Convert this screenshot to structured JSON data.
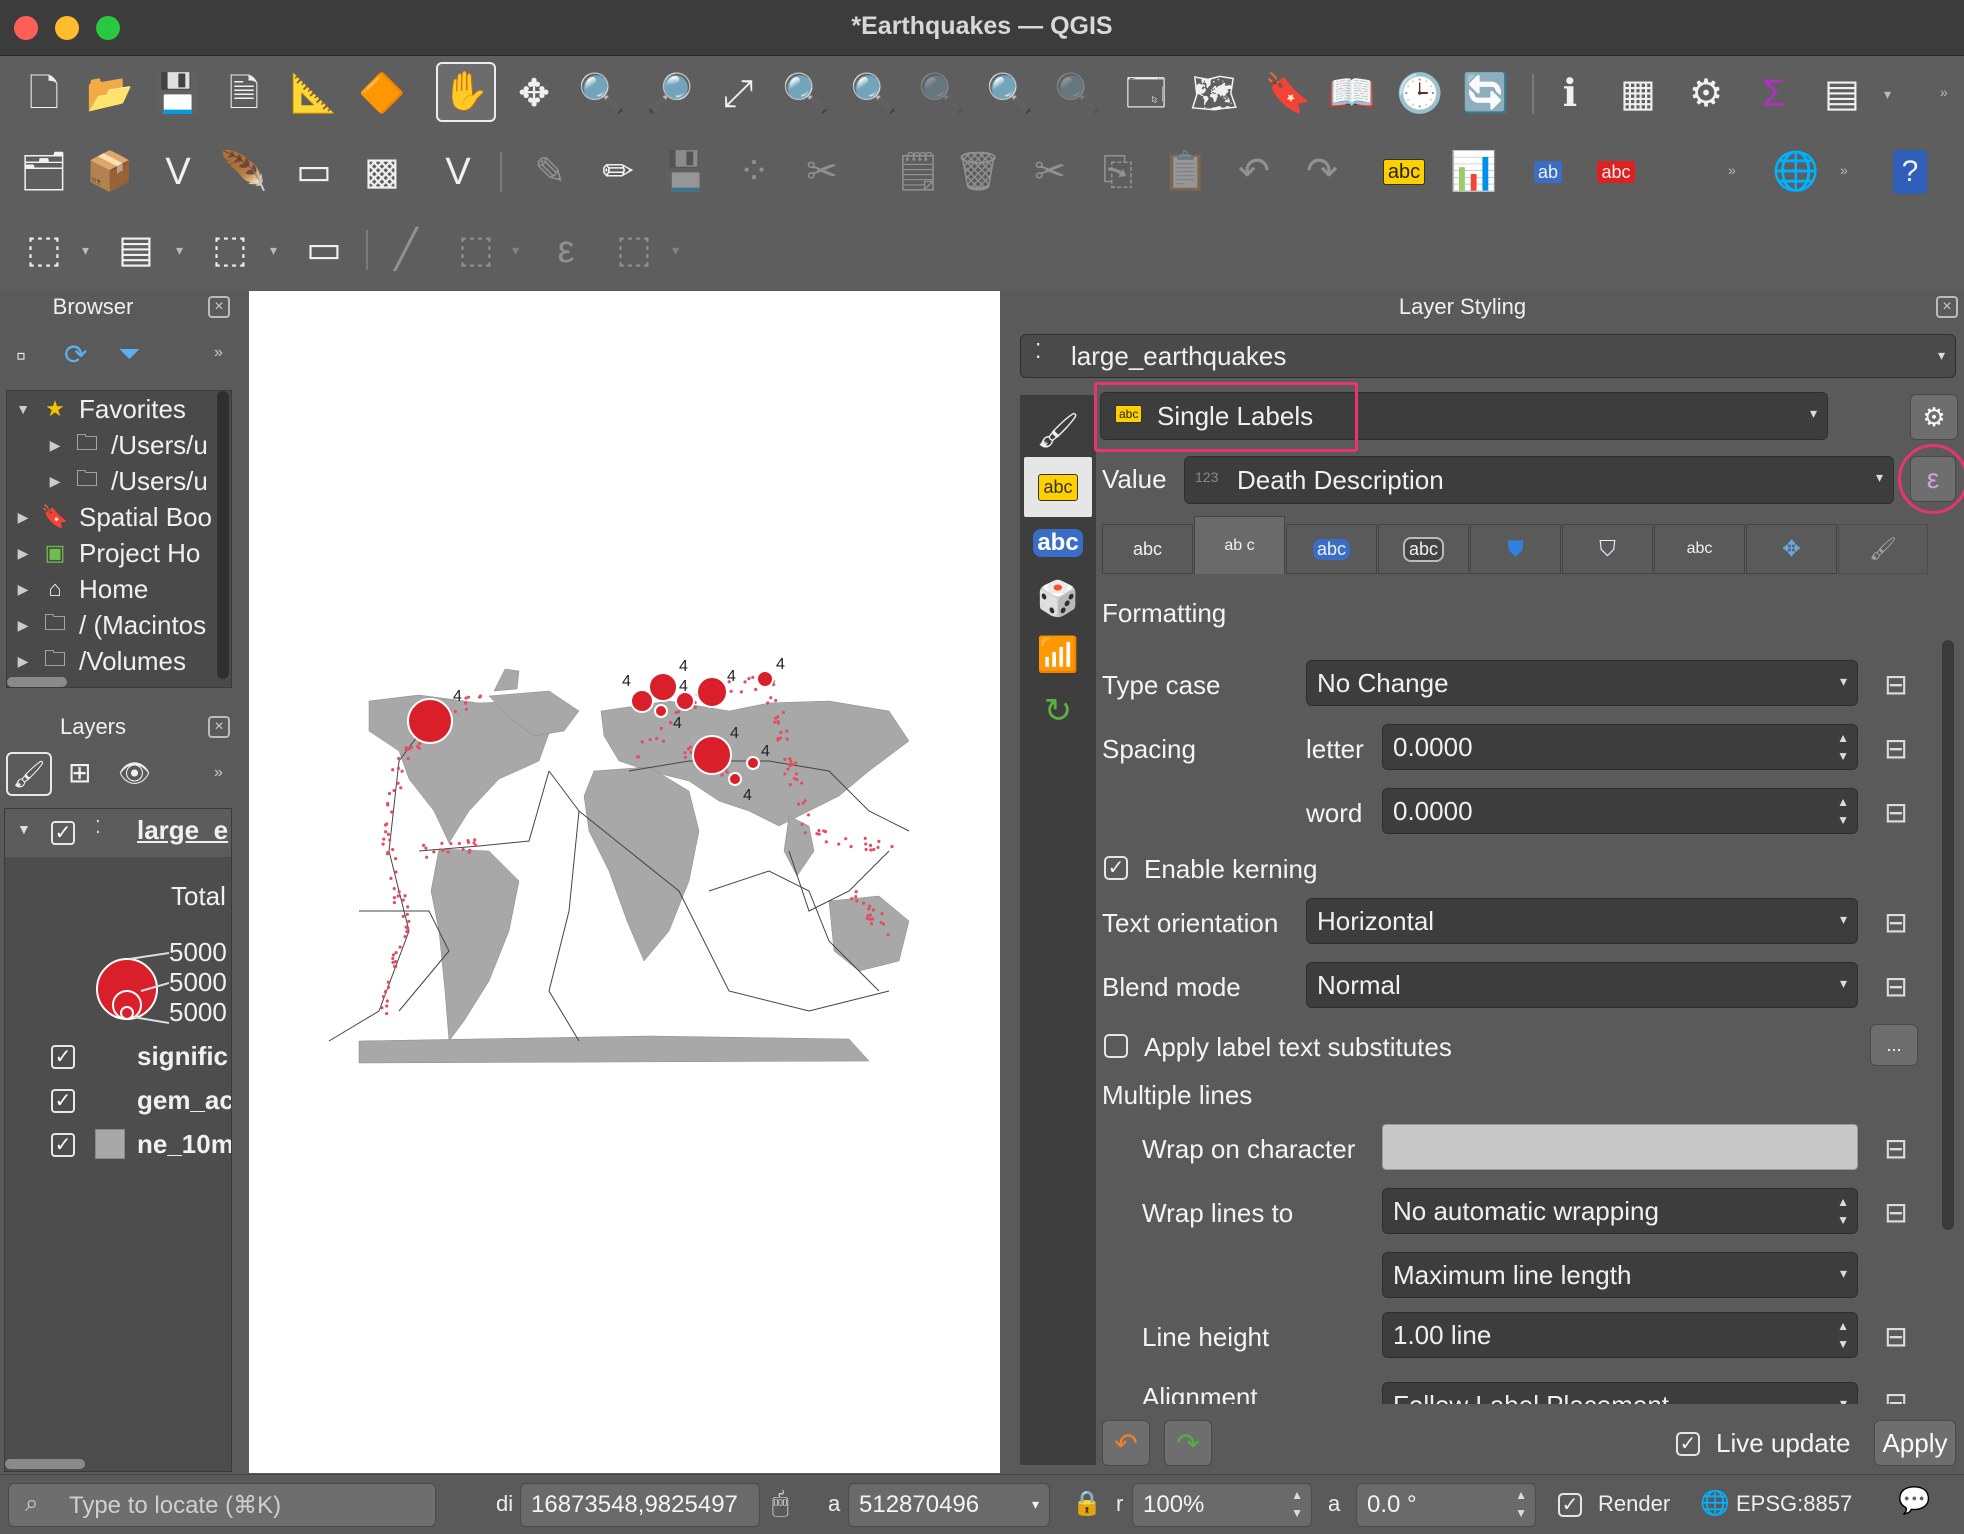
{
  "window": {
    "title": "*Earthquakes — QGIS"
  },
  "browser": {
    "title": "Browser",
    "items": [
      {
        "label": "Favorites",
        "icon": "star-icon"
      },
      {
        "label": "/Users/u",
        "icon": "folder-icon"
      },
      {
        "label": "/Users/u",
        "icon": "folder-icon"
      },
      {
        "label": "Spatial Boo",
        "icon": "bookmark-icon"
      },
      {
        "label": "Project Ho",
        "icon": "project-home-icon"
      },
      {
        "label": "Home",
        "icon": "home-icon"
      },
      {
        "label": "/ (Macintos",
        "icon": "folder-icon"
      },
      {
        "label": "/Volumes",
        "icon": "folder-icon"
      }
    ]
  },
  "layers": {
    "title": "Layers",
    "main_layer": "large_e",
    "legend_title": "Total",
    "legend_values": [
      "5000",
      "5000",
      "5000"
    ],
    "other_layers": [
      "signific",
      "gem_ac",
      "ne_10m"
    ]
  },
  "map": {
    "labels": [
      "4",
      "4",
      "4",
      "4",
      "4",
      "4",
      "4",
      "4",
      "4",
      "4"
    ]
  },
  "styling": {
    "title": "Layer Styling",
    "layer": "large_earthquakes",
    "mode": "Single Labels",
    "value_label": "Value",
    "value": "Death Description",
    "value_type": "123",
    "tabs": [
      "abc",
      "ab c",
      "abc",
      "abc",
      "",
      "",
      "abc",
      "",
      ""
    ],
    "section": "Formatting",
    "type_case_label": "Type case",
    "type_case": "No Change",
    "spacing_label": "Spacing",
    "letter_label": "letter",
    "letter": "0.0000",
    "word_label": "word",
    "word": "0.0000",
    "kerning_label": "Enable kerning",
    "orientation_label": "Text orientation",
    "orientation": "Horizontal",
    "blend_label": "Blend mode",
    "blend": "Normal",
    "substitutes_label": "Apply label text substitutes",
    "substitutes_btn": "...",
    "multiple_lines": "Multiple lines",
    "wrap_char_label": "Wrap on character",
    "wrap_char": "",
    "wrap_lines_label": "Wrap lines to",
    "wrap_lines": "No automatic wrapping",
    "max_line": "Maximum line length",
    "line_height_label": "Line height",
    "line_height": "1.00 line",
    "alignment_label": "Alignment",
    "alignment": "Follow Label Placement",
    "live_update": "Live update",
    "apply": "Apply"
  },
  "status": {
    "locator_placeholder": "Type to locate (⌘K)",
    "coord_label": "di",
    "coordinate": "16873548,9825497",
    "scale_label": "a",
    "scale": "512870496",
    "mag_label": "r",
    "magnifier": "100%",
    "rot_label": "a",
    "rotation": "0.0 °",
    "render": "Render",
    "crs": "EPSG:8857"
  },
  "colors": {
    "highlight": "#e8366c",
    "quake": "#d9202a",
    "land": "#a8a8a8"
  }
}
